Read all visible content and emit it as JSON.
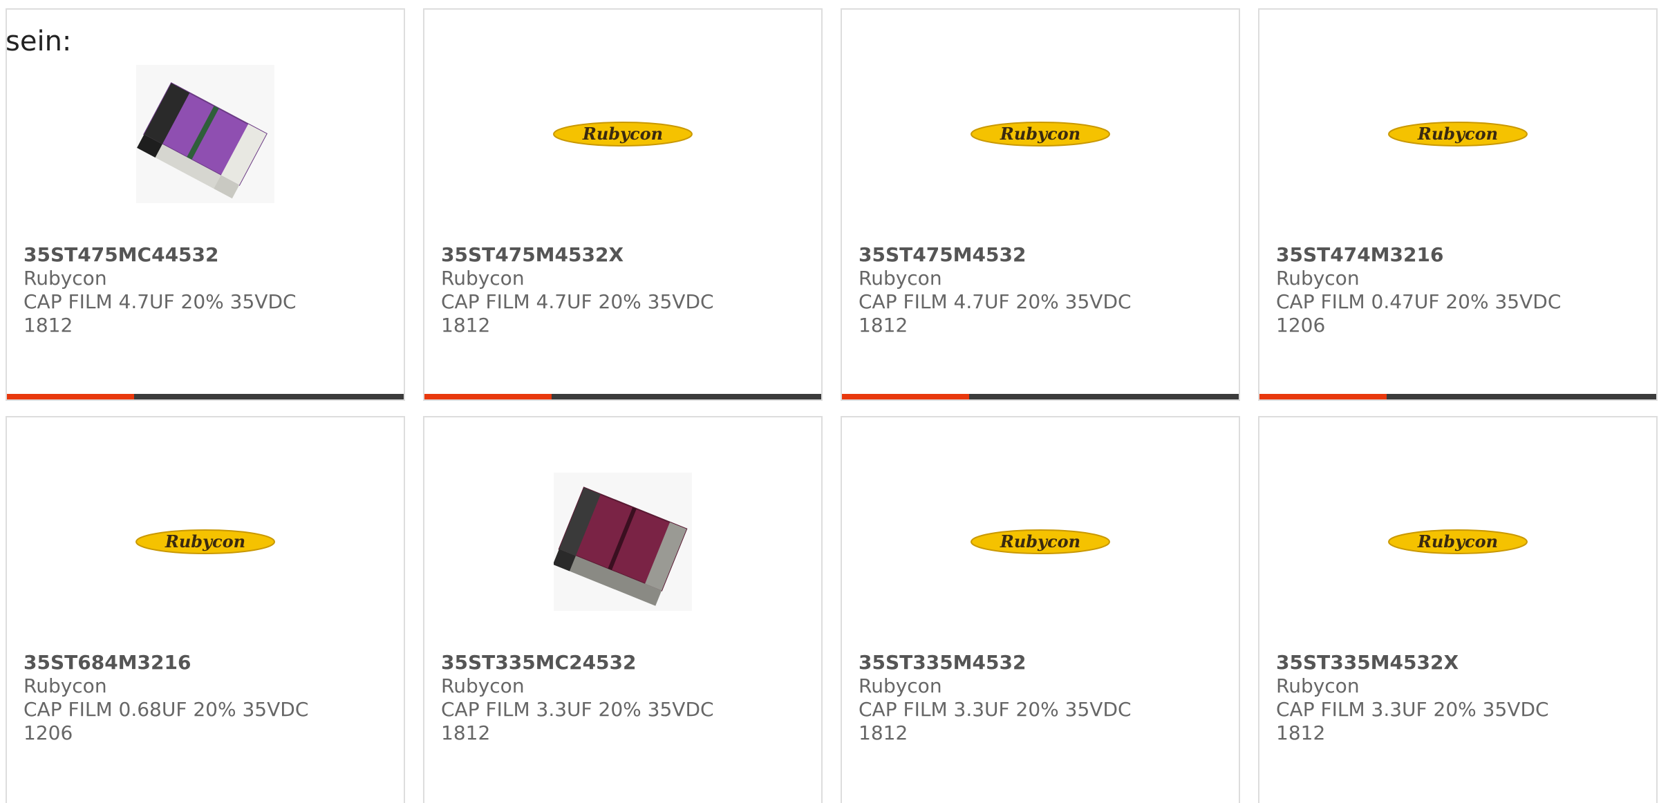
{
  "intro": {
    "text": "sein:"
  },
  "colors": {
    "accent": "#e8380d",
    "bar_dark": "#3b3b3b",
    "logo_yellow": "#f5c200",
    "logo_text": "#3a2a10",
    "text_gray": "#666666"
  },
  "products": [
    {
      "part_number": "35ST475MC44532",
      "manufacturer": "Rubycon",
      "description": "CAP FILM 4.7UF 20% 35VDC",
      "size": "1812",
      "image": "film-capacitor-purple-photo"
    },
    {
      "part_number": "35ST475M4532X",
      "manufacturer": "Rubycon",
      "description": "CAP FILM 4.7UF 20% 35VDC",
      "size": "1812",
      "image": "rubycon-logo",
      "logo_text": "Rubycon"
    },
    {
      "part_number": "35ST475M4532",
      "manufacturer": "Rubycon",
      "description": "CAP FILM 4.7UF 20% 35VDC",
      "size": "1812",
      "image": "rubycon-logo",
      "logo_text": "Rubycon"
    },
    {
      "part_number": "35ST474M3216",
      "manufacturer": "Rubycon",
      "description": "CAP FILM 0.47UF 20% 35VDC",
      "size": "1206",
      "image": "rubycon-logo",
      "logo_text": "Rubycon"
    },
    {
      "part_number": "35ST684M3216",
      "manufacturer": "Rubycon",
      "description": "CAP FILM 0.68UF 20% 35VDC",
      "size": "1206",
      "image": "rubycon-logo",
      "logo_text": "Rubycon"
    },
    {
      "part_number": "35ST335MC24532",
      "manufacturer": "Rubycon",
      "description": "CAP FILM 3.3UF 20% 35VDC",
      "size": "1812",
      "image": "film-capacitor-maroon-photo"
    },
    {
      "part_number": "35ST335M4532",
      "manufacturer": "Rubycon",
      "description": "CAP FILM 3.3UF 20% 35VDC",
      "size": "1812",
      "image": "rubycon-logo",
      "logo_text": "Rubycon"
    },
    {
      "part_number": "35ST335M4532X",
      "manufacturer": "Rubycon",
      "description": "CAP FILM 3.3UF 20% 35VDC",
      "size": "1812",
      "image": "rubycon-logo",
      "logo_text": "Rubycon"
    }
  ]
}
